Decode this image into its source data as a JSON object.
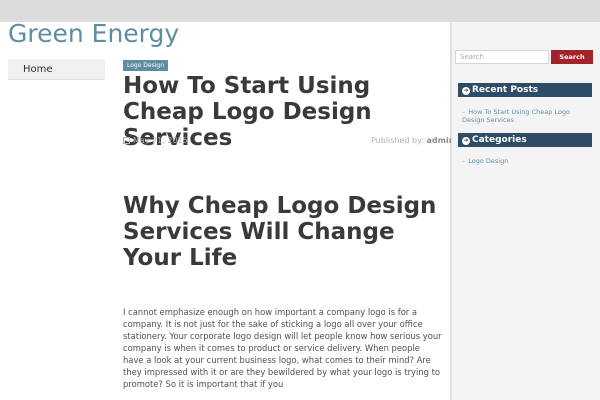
{
  "site": {
    "title": "Green Energy"
  },
  "nav": {
    "items": [
      {
        "label": "Home"
      }
    ]
  },
  "post": {
    "category": "Logo Design",
    "title": "How To Start Using Cheap Logo Design Services",
    "date": "May 21, 2015",
    "published_by_label": "Published by:",
    "author": "admin",
    "subheading": "Why Cheap Logo Design Services Will Change Your Life",
    "body": "I cannot emphasize enough on how important a company logo is for a company. It is not just for the sake of sticking a logo all over your office stationery. Your corporate logo design will let people know how serious your company is when it comes to product or service delivery. When people have a look at your current business logo, what comes to their mind? Are they impressed with it or are they bewildered by what your logo is trying to promote? So it is important that if you"
  },
  "sidebar": {
    "search": {
      "placeholder": "Search",
      "button_label": "Search"
    },
    "recent_posts": {
      "title": "Recent Posts",
      "icon": "arrow-circle-icon",
      "items": [
        {
          "label": "How To Start Using Cheap Logo Design Services"
        }
      ]
    },
    "categories": {
      "title": "Categories",
      "icon": "arrow-circle-icon",
      "items": [
        {
          "label": "Logo Design"
        }
      ]
    }
  },
  "colors": {
    "accent": "#5f8ea3",
    "widget_header": "#2e4c67",
    "search_button": "#a3232b",
    "heading": "#3a3a3a"
  }
}
